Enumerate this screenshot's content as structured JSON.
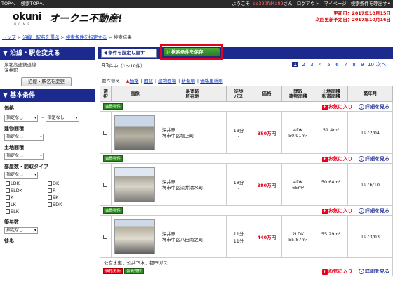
{
  "topbar": {
    "links": [
      "TOPへ",
      "検索TOPへ"
    ],
    "welcome": "ようこそ",
    "user": "do320fd4a89",
    "suffix": "さん",
    "logout": "ログアウト",
    "mypage": "マイページ",
    "call": "検索条件を呼出す"
  },
  "header": {
    "logo_main": "okuni",
    "logo_sub": "H O M E",
    "logo_jp": "オークニ不動産!",
    "updated": "更新日：2017年10月15日",
    "next_update": "次回更新予定日：2017年10月16日"
  },
  "breadcrumb": [
    "トップ",
    "沿線・駅名を選ぶ",
    "検索条件を指定する",
    "検索結果"
  ],
  "sidebar": {
    "line_head": "沿線・駅を変える",
    "line_value1": "泉北高速鉄道線",
    "line_value2": "深井駅",
    "line_button": "沿線・駅名を変更",
    "basic_head": "基本条件",
    "price_label": "価格",
    "price_min": "指定なし",
    "price_sep": "〜",
    "price_max": "指定なし",
    "building_label": "建物面積",
    "building_min": "指定なし",
    "land_label": "土地面積",
    "land_min": "指定なし",
    "rooms_label": "部屋数・間取タイプ",
    "rooms_min": "指定なし",
    "layouts": [
      "LDK",
      "DK",
      "SLDK",
      "R",
      "K",
      "SK",
      "LK",
      "SDK",
      "SLK"
    ],
    "age_label": "築年数",
    "age_min": "指定なし",
    "walk_label": "徒歩"
  },
  "main": {
    "cond_button": "条件を設定し直す",
    "save_button": "検索条件を保存",
    "count": "93",
    "count_suffix": "件中（1〜10件）",
    "pages": [
      "1",
      "2",
      "3",
      "4",
      "5",
      "6",
      "7",
      "8",
      "9",
      "10"
    ],
    "next": "次へ",
    "sort_label": "並べ替え：",
    "sort_options": [
      "価格",
      "間取",
      "建物面積",
      "新着順",
      "価格更新順"
    ],
    "columns": [
      "選択",
      "画像",
      "最寄駅\n所在地",
      "徒歩\nバス",
      "価格",
      "間取\n建物面積",
      "土地面積\n私道面積",
      "築年月"
    ],
    "fav_label": "お気に入り",
    "detail_label": "詳細を見る",
    "listings": [
      {
        "tag": "会員物件",
        "tag_color": "#2c8a20",
        "station": "深井駅",
        "address": "堺市中区堀上町",
        "walk": "13分",
        "bus": "-",
        "price": "350万円",
        "layout": "4DK",
        "building": "50.91m²",
        "land": "51.4m²",
        "private_road": "-",
        "built": "1972/04"
      },
      {
        "tag": "会員物件",
        "tag_color": "#2c8a20",
        "station": "深井駅",
        "address": "堺市中区深井清水町",
        "walk": "18分",
        "bus": "-",
        "price": "380万円",
        "layout": "4DK",
        "building": "65m²",
        "land": "50.64m²",
        "private_road": "-",
        "built": "1976/10"
      },
      {
        "tag": "会員物件",
        "tag_color": "#2c8a20",
        "station": "深井駅",
        "address": "堺市中区八田南之町",
        "walk": "11分",
        "bus": "11分",
        "price": "440万円",
        "layout": "2LDK",
        "building": "55.87m²",
        "land": "55.29m²",
        "private_road": "-",
        "built": "1973/03"
      }
    ],
    "note": "公営水道、公共下水、都市ガス",
    "next_tags": [
      "価格更新",
      "会員物件"
    ]
  }
}
